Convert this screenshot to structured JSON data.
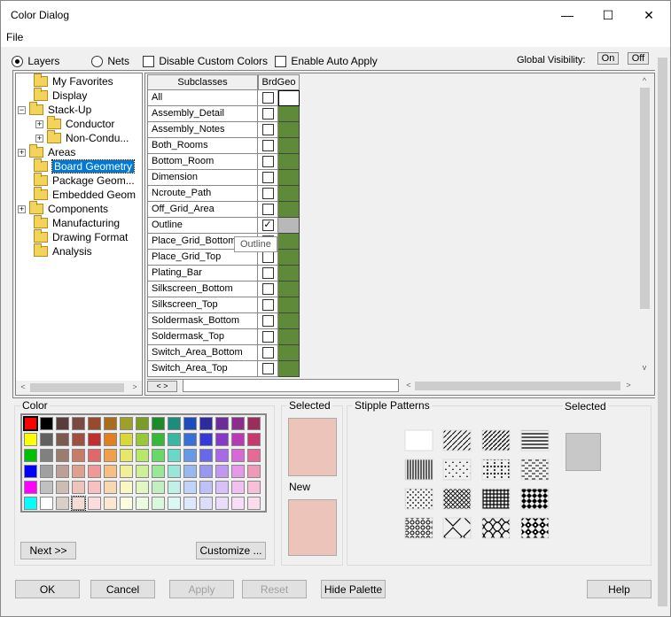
{
  "window": {
    "title": "Color Dialog",
    "minimize": "—",
    "maximize": "☐",
    "close": "✕"
  },
  "menu": {
    "file": "File"
  },
  "toolbar": {
    "layers_label": "Layers",
    "nets_label": "Nets",
    "disable_custom_colors": "Disable Custom Colors",
    "enable_auto_apply": "Enable Auto Apply",
    "global_visibility": "Global Visibility:",
    "on_label": "On",
    "off_label": "Off"
  },
  "tree": {
    "items": [
      {
        "label": "My Favorites"
      },
      {
        "label": "Display"
      },
      {
        "label": "Stack-Up"
      },
      {
        "label": "Conductor"
      },
      {
        "label": "Non-Condu..."
      },
      {
        "label": "Areas"
      },
      {
        "label": "Board Geometry"
      },
      {
        "label": "Package Geom..."
      },
      {
        "label": "Embedded Geom"
      },
      {
        "label": "Components"
      },
      {
        "label": "Manufacturing"
      },
      {
        "label": "Drawing Format"
      },
      {
        "label": "Analysis"
      }
    ]
  },
  "grid": {
    "col_subclasses": "Subclasses",
    "col_brdgeo": "BrdGeo",
    "rows": [
      {
        "name": "All",
        "checked": ""
      },
      {
        "name": "Assembly_Detail",
        "checked": ""
      },
      {
        "name": "Assembly_Notes",
        "checked": ""
      },
      {
        "name": "Both_Rooms",
        "checked": ""
      },
      {
        "name": "Bottom_Room",
        "checked": ""
      },
      {
        "name": "Dimension",
        "checked": ""
      },
      {
        "name": "Ncroute_Path",
        "checked": ""
      },
      {
        "name": "Off_Grid_Area",
        "checked": ""
      },
      {
        "name": "Outline",
        "checked": "✓"
      },
      {
        "name": "Place_Grid_Bottom",
        "checked": ""
      },
      {
        "name": "Place_Grid_Top",
        "checked": ""
      },
      {
        "name": "Plating_Bar",
        "checked": ""
      },
      {
        "name": "Silkscreen_Bottom",
        "checked": ""
      },
      {
        "name": "Silkscreen_Top",
        "checked": ""
      },
      {
        "name": "Soldermask_Bottom",
        "checked": ""
      },
      {
        "name": "Soldermask_Top",
        "checked": ""
      },
      {
        "name": "Switch_Area_Bottom",
        "checked": ""
      },
      {
        "name": "Switch_Area_Top",
        "checked": ""
      }
    ],
    "tooltip": "Outline",
    "layer_color": "#5f8a37"
  },
  "palette": {
    "label": "Color",
    "selected_label": "Selected",
    "new_label": "New",
    "selected_color": "#ecc4b9",
    "new_color": "#ecc4b9",
    "next_button": "Next >>",
    "customize_button": "Customize ...",
    "colors": [
      [
        "#ff0000",
        "#000000",
        "#5a3c3c",
        "#7a4a42",
        "#984a2c",
        "#a86c1c",
        "#a0a028",
        "#7c9c28",
        "#1c8c28",
        "#1c8c7c",
        "#1c4cbc",
        "#2c2ca0",
        "#6c2c9c",
        "#8c2c8c",
        "#9c2c5c"
      ],
      [
        "#ffff00",
        "#606060",
        "#7c5a50",
        "#a05040",
        "#c03030",
        "#e08020",
        "#d8d838",
        "#98c838",
        "#38b838",
        "#38b8a0",
        "#3870d8",
        "#3838d8",
        "#8838c8",
        "#b838b8",
        "#c83870"
      ],
      [
        "#00c000",
        "#808080",
        "#9c7c70",
        "#c87c68",
        "#e06868",
        "#f0a048",
        "#e8e868",
        "#b8e868",
        "#68d868",
        "#68d8c8",
        "#6898e8",
        "#6868e8",
        "#a868e8",
        "#d868d8",
        "#e86898"
      ],
      [
        "#0000ff",
        "#a0a0a0",
        "#bca098",
        "#e0a090",
        "#f09898",
        "#f8c080",
        "#f0f098",
        "#d0f098",
        "#98e898",
        "#98e8d8",
        "#98b8f0",
        "#9898f0",
        "#c098f0",
        "#e898e8",
        "#f098b8"
      ],
      [
        "#ff00ff",
        "#c0c0c0",
        "#ccbcb4",
        "#ecc4b9",
        "#f8c0c0",
        "#f8d8b0",
        "#f8f8c0",
        "#e0f8c0",
        "#c0f0c0",
        "#c0f0e8",
        "#c0d4f8",
        "#c0c0f8",
        "#d8c0f8",
        "#f0c0f0",
        "#f8c0d8"
      ],
      [
        "#00ffff",
        "#ffffff",
        "#d8d0c8",
        "#f4dcd4",
        "#fcdcdc",
        "#fce8d0",
        "#fcfce0",
        "#ecfce0",
        "#dcf8dc",
        "#dcf8f4",
        "#dce8fc",
        "#dcdcfc",
        "#ecdcfc",
        "#f8dcf8",
        "#fcdcec"
      ]
    ]
  },
  "stipple": {
    "label": "Stipple Patterns",
    "selected_label": "Selected",
    "selected_color": "#c8c8c8"
  },
  "buttons": {
    "ok": "OK",
    "cancel": "Cancel",
    "apply": "Apply",
    "reset": "Reset",
    "hide_palette": "Hide Palette",
    "help": "Help"
  }
}
